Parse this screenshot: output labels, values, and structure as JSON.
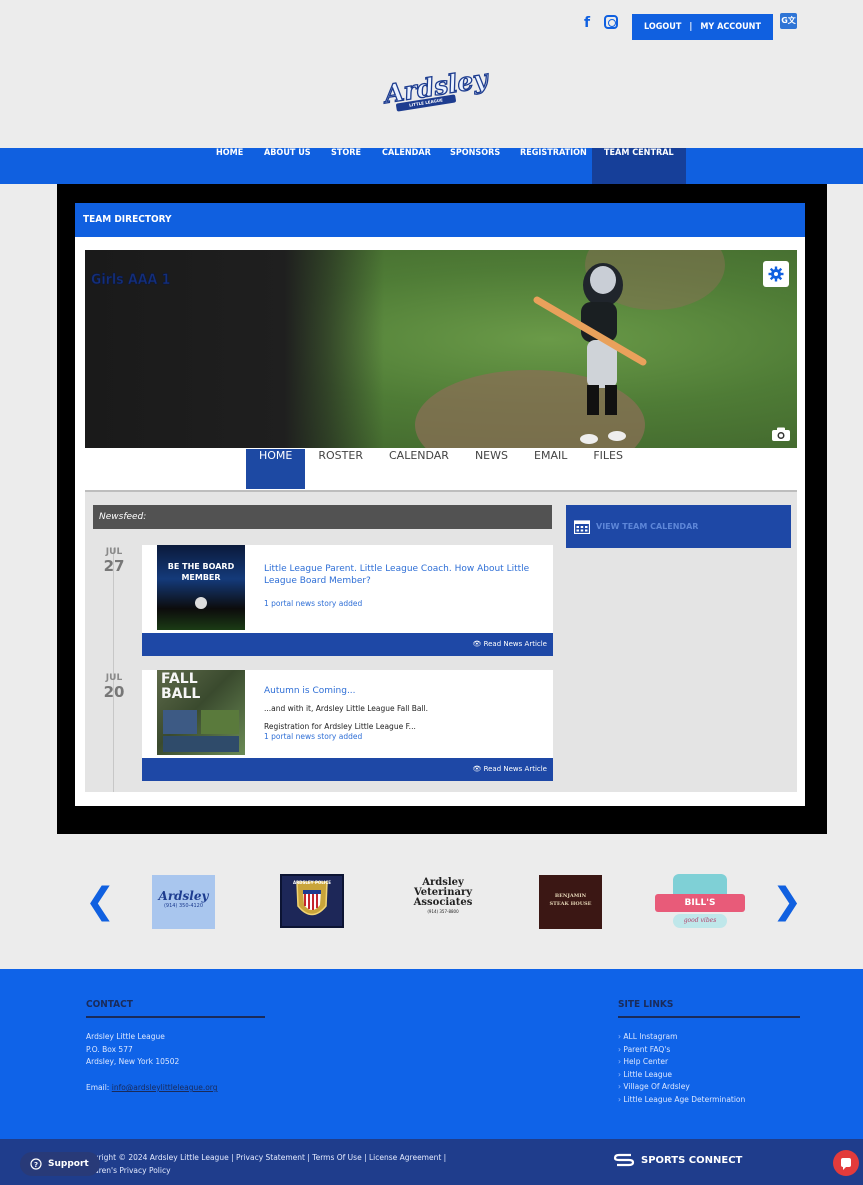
{
  "header": {
    "social": {
      "facebook_glyph": "f",
      "instagram": "instagram-icon"
    },
    "account": {
      "logout": "LOGOUT",
      "separator": "|",
      "my_account": "MY ACCOUNT"
    },
    "translate_glyph": "G文",
    "logo": {
      "word": "Ardsley",
      "banner": "LITTLE LEAGUE"
    }
  },
  "nav": {
    "items": [
      "HOME",
      "ABOUT US",
      "STORE",
      "CALENDAR",
      "SPONSORS",
      "REGISTRATION",
      "TEAM CENTRAL"
    ],
    "active": "TEAM CENTRAL"
  },
  "team": {
    "directory_title": "TEAM DIRECTORY",
    "name": "Girls AAA 1",
    "tabs": [
      "HOME",
      "ROSTER",
      "CALENDAR",
      "NEWS",
      "EMAIL",
      "FILES"
    ],
    "active_tab": "HOME"
  },
  "newsfeed": {
    "header": "Newsfeed:",
    "calendar_button": "VIEW TEAM CALENDAR",
    "items": [
      {
        "month": "JUL",
        "day": "27",
        "title": "Little League Parent. Little League Coach. How About Little League Board Member?",
        "body_lines": [],
        "meta": "1 portal news story added",
        "footer": "Read News Article",
        "thumb_caption": "BE THE BOARD MEMBER"
      },
      {
        "month": "JUL",
        "day": "20",
        "title": "Autumn is Coming...",
        "body_lines": [
          "...and with it, Ardsley Little League Fall Ball.",
          "Registration for Ardsley Little League F..."
        ],
        "meta": "1 portal news story added",
        "footer": "Read News Article",
        "thumb_caption": "FALL BALL"
      }
    ]
  },
  "sponsors": {
    "prev_glyph": "❮",
    "next_glyph": "❯",
    "logos": [
      {
        "name": "Ardsley",
        "sub": "(914) 350-4120"
      },
      {
        "name": "ARDSLEY POLICE"
      },
      {
        "name": "Ardsley Veterinary Associates",
        "lines": [
          "Ardsley",
          "Veterinary",
          "Associates"
        ],
        "sub": "(914) 357-8800"
      },
      {
        "name": "BENJAMIN STEAK HOUSE",
        "lines": [
          "BENJAMIN",
          "STEAK HOUSE"
        ]
      },
      {
        "name": "BILL'S",
        "sub": "good vibes"
      }
    ]
  },
  "footer": {
    "contact": {
      "heading": "CONTACT",
      "lines": [
        "Ardsley Little League",
        "P.O. Box 577",
        "Ardsley, New York 10502"
      ],
      "email_label": "Email:",
      "email": "info@ardsleylittleleague.org"
    },
    "site_links": {
      "heading": "SITE LINKS",
      "items": [
        "ALL Instagram",
        "Parent FAQ's",
        "Help Center",
        "Little League",
        "Village Of Ardsley",
        "Little League Age Determination"
      ]
    },
    "copyright_line1": "yright © 2024 Ardsley Little League | Privacy Statement | Terms Of Use | License Agreement |",
    "copyright_line2": "dren's Privacy Policy",
    "brand": "SPORTS CONNECT",
    "support_label": "Support"
  },
  "colors": {
    "brand_blue": "#1060e0",
    "dark_blue": "#1e48a6",
    "footer_bottom": "#1f3d8c",
    "chat_red": "#e33b3b"
  }
}
